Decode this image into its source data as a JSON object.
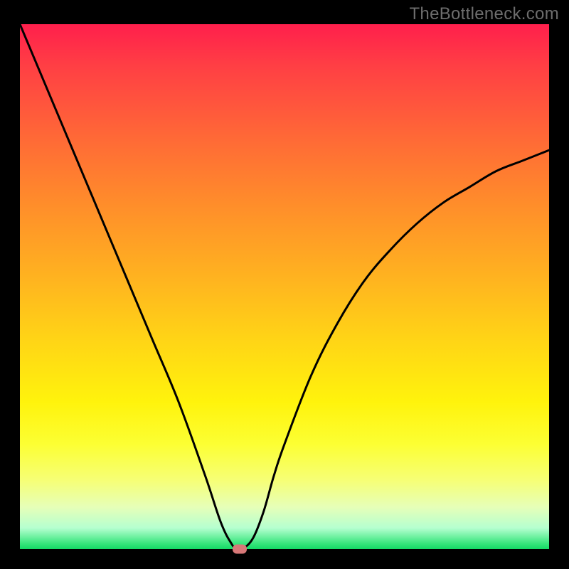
{
  "watermark": "TheBottleneck.com",
  "chart_data": {
    "type": "line",
    "title": "",
    "xlabel": "",
    "ylabel": "",
    "xlim": [
      0,
      100
    ],
    "ylim": [
      0,
      100
    ],
    "grid": false,
    "legend": null,
    "series": [
      {
        "name": "curve",
        "color": "#000000",
        "x": [
          0,
          5,
          10,
          15,
          20,
          25,
          30,
          35,
          38,
          40,
          41,
          42,
          44,
          46,
          48,
          50,
          55,
          60,
          65,
          70,
          75,
          80,
          85,
          90,
          95,
          100
        ],
        "y": [
          100,
          88,
          76,
          64,
          52,
          40,
          28,
          14,
          5,
          1,
          0,
          0,
          2,
          7,
          14,
          20,
          33,
          43,
          51,
          57,
          62,
          66,
          69,
          72,
          74,
          76
        ]
      }
    ],
    "min_marker": {
      "x": 41.5,
      "y": 0
    },
    "gradient": {
      "stops": [
        {
          "pos": 0.0,
          "color": "#ff1f4c"
        },
        {
          "pos": 0.08,
          "color": "#ff3f44"
        },
        {
          "pos": 0.22,
          "color": "#ff6a36"
        },
        {
          "pos": 0.35,
          "color": "#ff8f2a"
        },
        {
          "pos": 0.48,
          "color": "#ffb220"
        },
        {
          "pos": 0.6,
          "color": "#ffd416"
        },
        {
          "pos": 0.72,
          "color": "#fff30c"
        },
        {
          "pos": 0.8,
          "color": "#fcff33"
        },
        {
          "pos": 0.87,
          "color": "#f6ff77"
        },
        {
          "pos": 0.92,
          "color": "#e6ffb8"
        },
        {
          "pos": 0.96,
          "color": "#b5ffd0"
        },
        {
          "pos": 0.99,
          "color": "#35e57a"
        },
        {
          "pos": 1.0,
          "color": "#14d964"
        }
      ]
    }
  }
}
